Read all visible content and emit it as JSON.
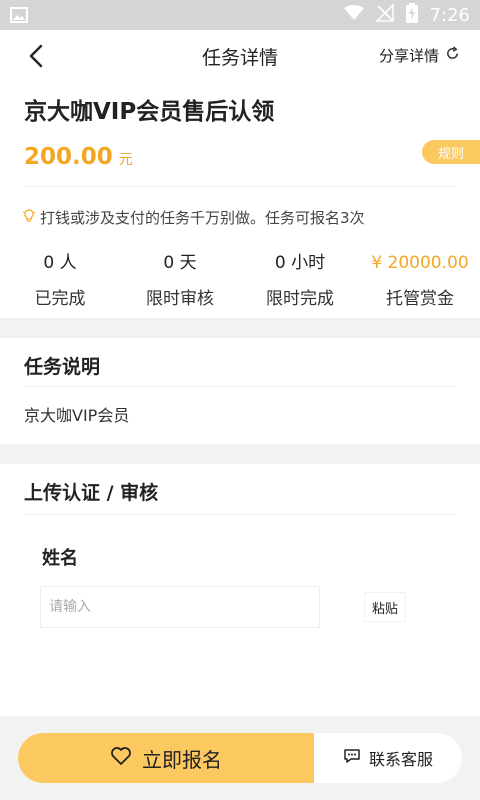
{
  "status_bar": {
    "time": "7:26"
  },
  "header": {
    "title": "任务详情",
    "share_label": "分享详情"
  },
  "task": {
    "title": "京大咖VIP会员售后认领",
    "price": "200.00",
    "price_unit": "元",
    "rules_label": "规则",
    "tip": "打钱或涉及支付的任务千万别做。任务可报名3次"
  },
  "stats": [
    {
      "value": "0 人",
      "label": "已完成"
    },
    {
      "value": "0 天",
      "label": "限时审核"
    },
    {
      "value": "0 小时",
      "label": "限时完成"
    },
    {
      "value": "¥ 20000.00",
      "label": "托管赏金"
    }
  ],
  "description": {
    "title": "任务说明",
    "text": "京大咖VIP会员"
  },
  "upload": {
    "title": "上传认证 / 审核",
    "field_label": "姓名",
    "input_placeholder": "请输入",
    "input_value": "",
    "paste_label": "粘贴"
  },
  "bottom": {
    "signup_label": "立即报名",
    "service_label": "联系客服"
  },
  "colors": {
    "accent": "#fcc860",
    "price": "#f5a623"
  }
}
